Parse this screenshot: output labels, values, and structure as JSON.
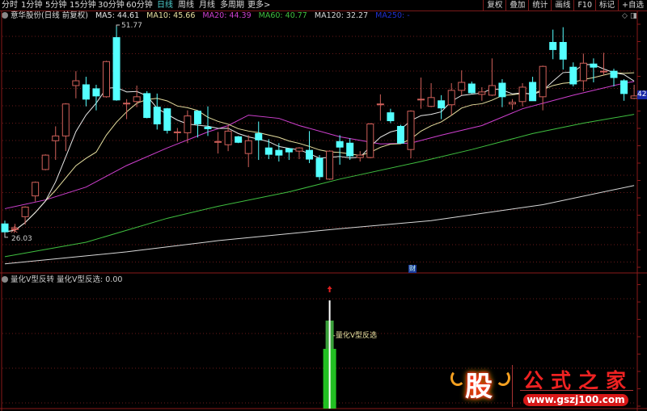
{
  "toolbar": {
    "periods": [
      "分时",
      "1分钟",
      "5分钟",
      "15分钟",
      "30分钟",
      "60分钟",
      "日线",
      "周线",
      "月线",
      "多周期",
      "更多>"
    ],
    "active_index": 6,
    "right_buttons": [
      "复权",
      "叠加",
      "统计",
      "画线",
      "F10",
      "标记",
      "+自选"
    ]
  },
  "legend": {
    "title": "意华股份(日线 前复权)",
    "ma5": "MA5: 44.61",
    "ma10": "MA10: 45.66",
    "ma20": "MA20: 44.39",
    "ma60": "MA60: 40.77",
    "ma120": "MA120: 32.27",
    "ma250": "MA250: -"
  },
  "colors": {
    "up": "#d0605a",
    "down": "#54ffff",
    "ma5": "#e8e8e8",
    "ma10": "#e8e0a0",
    "ma20": "#d040d0",
    "ma60": "#40c040",
    "ma120": "#d8d8d8",
    "ma250": "#2030d0",
    "grid": "#6a1a1a"
  },
  "main": {
    "high_label": "51.77",
    "low_label": "26.03",
    "last_price_label": "42",
    "cai_badge": "财",
    "marker_text": "宋"
  },
  "chart_data": {
    "type": "candlestick",
    "ylim": [
      21.5,
      52.8
    ],
    "candles": [
      [
        27.1,
        27.5,
        26.03,
        26.1
      ],
      [
        26.5,
        27.1,
        26.1,
        26.5
      ],
      [
        28.0,
        29.3,
        27.0,
        29.2
      ],
      [
        30.6,
        32.4,
        29.9,
        32.3
      ],
      [
        33.9,
        35.8,
        33.8,
        35.7
      ],
      [
        37.5,
        39.3,
        35.1,
        38.1
      ],
      [
        38.1,
        42.2,
        36.2,
        42.1
      ],
      [
        44.4,
        46.2,
        42.8,
        45.0
      ],
      [
        44.5,
        45.5,
        41.8,
        42.7
      ],
      [
        44.0,
        44.5,
        41.3,
        43.1
      ],
      [
        43.0,
        47.5,
        42.9,
        47.4
      ],
      [
        50.4,
        51.77,
        42.5,
        42.6
      ],
      [
        42.2,
        42.7,
        40.2,
        42.2
      ],
      [
        42.4,
        44.4,
        41.7,
        43.0
      ],
      [
        43.4,
        43.7,
        40.3,
        40.4
      ],
      [
        41.7,
        43.4,
        38.9,
        39.6
      ],
      [
        41.5,
        41.6,
        38.4,
        38.8
      ],
      [
        38.6,
        39.1,
        37.4,
        38.6
      ],
      [
        38.5,
        41.3,
        37.2,
        40.6
      ],
      [
        41.2,
        41.3,
        37.9,
        39.6
      ],
      [
        39.2,
        41.8,
        38.1,
        39.0
      ],
      [
        37.4,
        38.6,
        35.9,
        37.4
      ],
      [
        37.0,
        39.4,
        36.2,
        38.7
      ],
      [
        38.0,
        38.1,
        37.2,
        37.3
      ],
      [
        35.9,
        38.2,
        34.2,
        37.5
      ],
      [
        38.4,
        39.9,
        35.1,
        37.6
      ],
      [
        36.6,
        37.7,
        35.2,
        35.8
      ],
      [
        36.3,
        37.2,
        34.9,
        35.7
      ],
      [
        36.5,
        36.6,
        35.1,
        36.1
      ],
      [
        36.2,
        36.7,
        35.2,
        36.6
      ],
      [
        36.3,
        38.7,
        34.7,
        35.2
      ],
      [
        35.3,
        35.7,
        32.6,
        33.0
      ],
      [
        32.7,
        36.3,
        32.6,
        36.2
      ],
      [
        37.4,
        38.2,
        34.5,
        36.7
      ],
      [
        37.2,
        37.8,
        35.1,
        35.6
      ],
      [
        35.4,
        36.2,
        34.9,
        35.7
      ],
      [
        35.4,
        39.7,
        35.3,
        39.6
      ],
      [
        42.1,
        43.3,
        40.0,
        42.1
      ],
      [
        41.0,
        41.5,
        39.7,
        40.0
      ],
      [
        39.3,
        39.5,
        37.2,
        37.2
      ],
      [
        36.4,
        41.3,
        35.3,
        41.2
      ],
      [
        42.7,
        45.4,
        41.5,
        42.7
      ],
      [
        41.8,
        44.7,
        41.7,
        42.9
      ],
      [
        42.5,
        43.2,
        40.2,
        41.6
      ],
      [
        42.0,
        44.7,
        40.7,
        43.8
      ],
      [
        43.8,
        46.3,
        43.2,
        44.8
      ],
      [
        44.6,
        44.9,
        43.4,
        43.5
      ],
      [
        43.3,
        44.2,
        42.5,
        43.6
      ],
      [
        43.2,
        47.8,
        43.1,
        44.4
      ],
      [
        44.7,
        45.2,
        41.7,
        43.0
      ],
      [
        42.1,
        42.7,
        41.4,
        42.3
      ],
      [
        42.4,
        44.7,
        41.8,
        44.2
      ],
      [
        44.8,
        45.5,
        42.5,
        42.5
      ],
      [
        43.0,
        46.9,
        41.3,
        46.8
      ],
      [
        49.8,
        51.4,
        47.7,
        48.9
      ],
      [
        49.8,
        51.7,
        46.4,
        47.7
      ],
      [
        46.7,
        47.3,
        44.3,
        44.6
      ],
      [
        45.0,
        48.4,
        43.7,
        47.2
      ],
      [
        47.1,
        47.8,
        44.8,
        46.7
      ],
      [
        46.2,
        48.5,
        45.7,
        46.2
      ],
      [
        46.2,
        46.5,
        44.3,
        45.4
      ],
      [
        45.0,
        45.2,
        42.5,
        43.4
      ],
      [
        42.8,
        44.5,
        42.7,
        43.1
      ]
    ],
    "ma20": [
      [
        0,
        29.0
      ],
      [
        4,
        30.1
      ],
      [
        8,
        31.7
      ],
      [
        12,
        34.4
      ],
      [
        16,
        36.6
      ],
      [
        20,
        38.6
      ],
      [
        22,
        39.4
      ],
      [
        24,
        40.7
      ],
      [
        27,
        40.3
      ],
      [
        29,
        39.4
      ],
      [
        33,
        38.0
      ],
      [
        37,
        37.1
      ],
      [
        40,
        37.2
      ],
      [
        43,
        38.2
      ],
      [
        47,
        39.4
      ],
      [
        51,
        41.5
      ],
      [
        56,
        43.2
      ],
      [
        61,
        44.7
      ],
      [
        62,
        44.9
      ]
    ],
    "ma60": [
      [
        0,
        23.0
      ],
      [
        8,
        24.8
      ],
      [
        16,
        27.8
      ],
      [
        21,
        29.3
      ],
      [
        28,
        31.1
      ],
      [
        33,
        32.7
      ],
      [
        41,
        34.9
      ],
      [
        46,
        36.4
      ],
      [
        52,
        38.4
      ],
      [
        57,
        39.7
      ],
      [
        62,
        40.8
      ]
    ],
    "ma120": [
      [
        0,
        22.1
      ],
      [
        12,
        23.6
      ],
      [
        21,
        25.0
      ],
      [
        33,
        26.5
      ],
      [
        42,
        27.5
      ],
      [
        53,
        29.5
      ],
      [
        62,
        31.9
      ]
    ]
  },
  "indicator": {
    "name": "量化V型反转",
    "value_label": "量化V型反选: 0.00",
    "signal_label": "量化V型反选",
    "signal_index": 32
  },
  "watermark": {
    "char": "股",
    "title": "公式之家",
    "url": "www.gszj100.com"
  }
}
